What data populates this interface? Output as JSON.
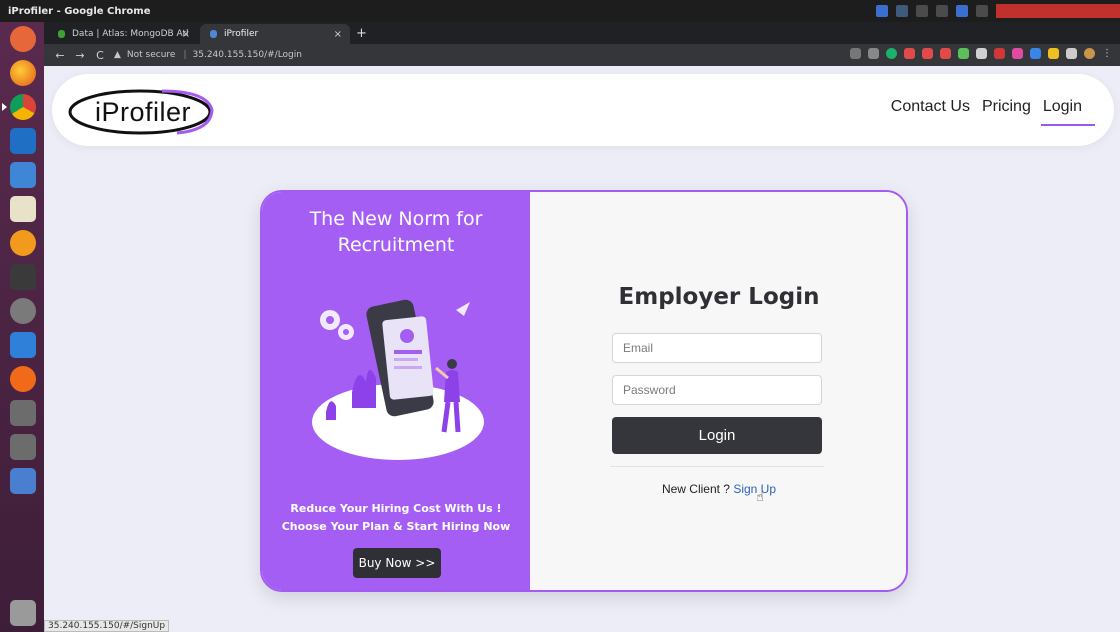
{
  "os": {
    "window_title": "iProfiler - Google Chrome"
  },
  "browser": {
    "tabs": [
      {
        "label": "Data | Atlas: MongoDB Atl",
        "close": "×"
      },
      {
        "label": "iProfiler",
        "close": "×"
      }
    ],
    "new_tab": "+",
    "nav": {
      "back": "←",
      "forward": "→",
      "reload": "C"
    },
    "address": {
      "security": "Not secure",
      "url": "35.240.155.150/#/Login"
    },
    "status_url": "35.240.155.150/#/SignUp"
  },
  "site": {
    "logo_text": "iProfiler",
    "nav": [
      {
        "label": "Contact Us"
      },
      {
        "label": "Pricing"
      },
      {
        "label": "Login",
        "active": true
      }
    ],
    "promo": {
      "headline_line1": "The New Norm for",
      "headline_line2": "Recruitment",
      "tagline_line1": "Reduce Your Hiring Cost With Us !",
      "tagline_line2": "Choose Your Plan & Start Hiring Now",
      "buy_label": "Buy Now >>"
    },
    "login": {
      "title": "Employer Login",
      "email_placeholder": "Email",
      "password_placeholder": "Password",
      "submit_label": "Login",
      "new_client_text": "New Client ?",
      "signup_label": "Sign Up"
    }
  },
  "colors": {
    "accent": "#a45ef4",
    "dark": "#34363c",
    "link": "#2b63b8"
  }
}
